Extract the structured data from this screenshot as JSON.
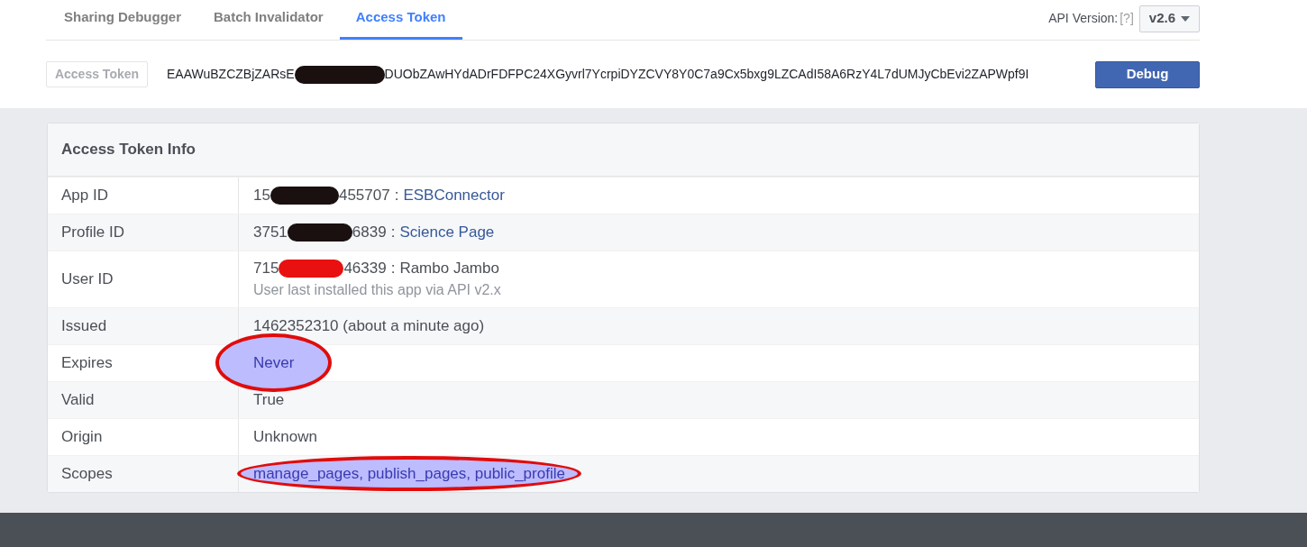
{
  "tabs": [
    {
      "label": "Sharing Debugger",
      "selected": false
    },
    {
      "label": "Batch Invalidator",
      "selected": false
    },
    {
      "label": "Access Token",
      "selected": true
    }
  ],
  "api_version": {
    "label": "API Version:",
    "help": "[?]",
    "value": "v2.6"
  },
  "token_bar": {
    "field_label": "Access Token",
    "token_start": "EAAWuBZCZBjZARsE",
    "token_end": "DUObZAwHYdADrFDFPC24XGyvrl7YcrpiDYZCVY8Y0C7a9Cx5bxg9LZCAdI58A6RzY4L7dUMJyCbEvi2ZAPWpf9I",
    "redaction": {
      "color": "#1a1010"
    },
    "button": "Debug"
  },
  "card": {
    "title": "Access Token Info",
    "rows": [
      {
        "label": "App ID",
        "kind": "id",
        "id_start": "15",
        "id_end": "455707",
        "redaction": {
          "color": "#1a1010"
        },
        "separator": ":",
        "name": "ESBConnector",
        "name_is_link": true,
        "highlighted": false
      },
      {
        "label": "Profile ID",
        "kind": "id",
        "id_start": "3751",
        "id_end": "6839",
        "redaction": {
          "color": "#1a1010"
        },
        "separator": ":",
        "name": "Science Page",
        "name_is_link": true,
        "highlighted": false
      },
      {
        "label": "User ID",
        "kind": "id",
        "id_start": "715",
        "id_end": "46339",
        "redaction": {
          "color": "#e81010"
        },
        "separator": ":",
        "name": "Rambo Jambo",
        "name_is_link": false,
        "note": "User last installed this app via API v2.x",
        "highlighted": false
      },
      {
        "label": "Issued",
        "kind": "text",
        "value": "1462352310 (about a minute ago)",
        "highlighted": false
      },
      {
        "label": "Expires",
        "kind": "text",
        "value": "Never",
        "highlighted": true
      },
      {
        "label": "Valid",
        "kind": "text",
        "value": "True",
        "highlighted": false
      },
      {
        "label": "Origin",
        "kind": "text",
        "value": "Unknown",
        "highlighted": false
      },
      {
        "label": "Scopes",
        "kind": "text",
        "value": "manage_pages, publish_pages, public_profile",
        "link": true,
        "highlighted": true
      }
    ]
  }
}
